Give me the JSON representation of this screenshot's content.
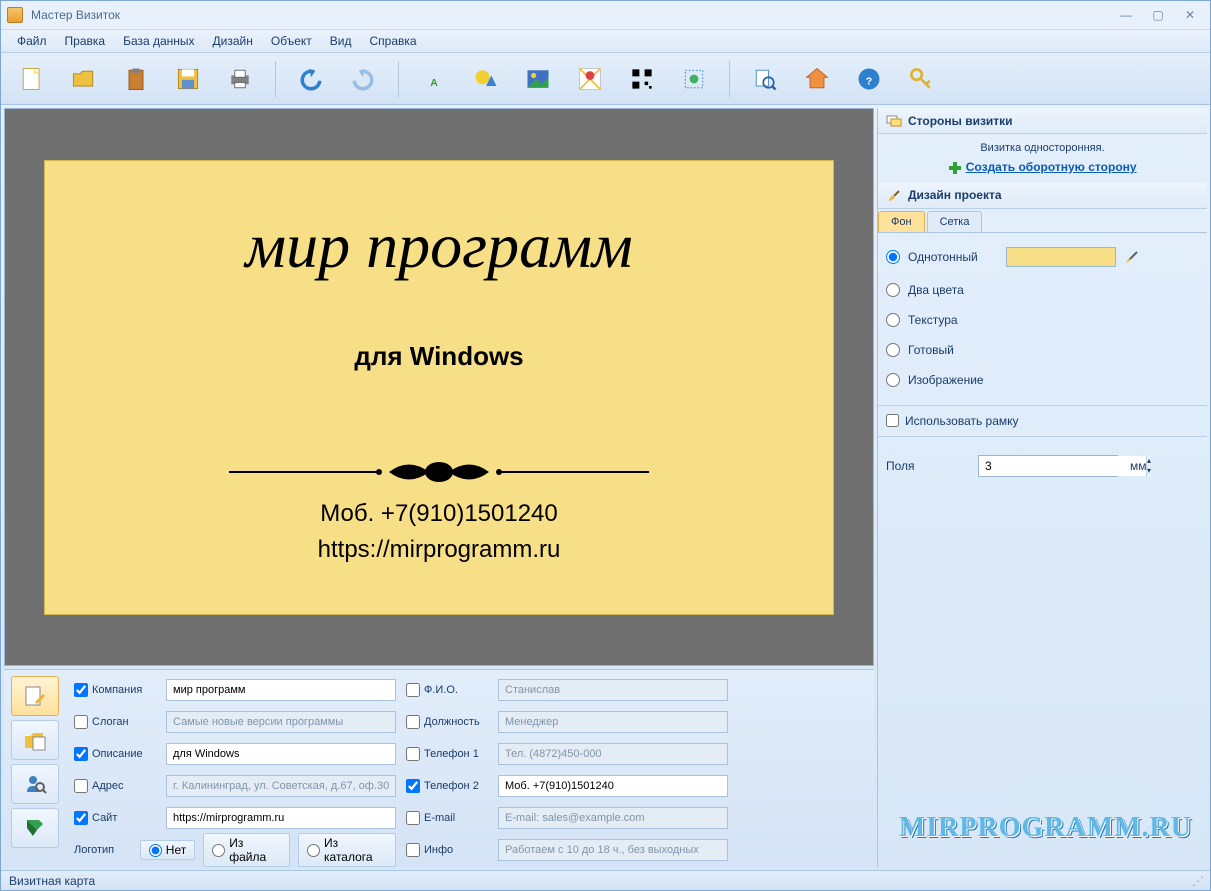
{
  "window": {
    "title": "Мастер Визиток"
  },
  "menu": [
    "Файл",
    "Правка",
    "База данных",
    "Дизайн",
    "Объект",
    "Вид",
    "Справка"
  ],
  "toolbar_icons": [
    "new",
    "open",
    "paste",
    "save",
    "print",
    "undo",
    "redo",
    "text",
    "shape",
    "image",
    "map",
    "qrcode",
    "clipart",
    "preview",
    "home",
    "help",
    "key"
  ],
  "card": {
    "company": "мир программ",
    "desc": "для Windows",
    "phone": "Моб. +7(910)1501240",
    "site": "https://mirprogramm.ru"
  },
  "fields": {
    "company": {
      "label": "Компания",
      "checked": true,
      "value": "мир программ"
    },
    "slogan": {
      "label": "Слоган",
      "checked": false,
      "value": "Самые новые версии программы"
    },
    "desc": {
      "label": "Описание",
      "checked": true,
      "value": "для Windows"
    },
    "address": {
      "label": "Адрес",
      "checked": false,
      "value": "г. Калининград, ул. Советская, д.67, оф.30"
    },
    "site": {
      "label": "Сайт",
      "checked": true,
      "value": "https://mirprogramm.ru"
    },
    "logo_label": "Логотип",
    "logo_none": "Нет",
    "logo_file": "Из файла",
    "logo_catalog": "Из каталога",
    "fio": {
      "label": "Ф.И.О.",
      "checked": false,
      "value": "Станислав"
    },
    "position": {
      "label": "Должность",
      "checked": false,
      "value": "Менеджер"
    },
    "phone1": {
      "label": "Телефон 1",
      "checked": false,
      "value": "Тел. (4872)450-000"
    },
    "phone2": {
      "label": "Телефон 2",
      "checked": true,
      "value": "Моб. +7(910)1501240"
    },
    "email": {
      "label": "E-mail",
      "checked": false,
      "value": "E-mail: sales@example.com"
    },
    "info": {
      "label": "Инфо",
      "checked": false,
      "value": "Работаем с 10 до 18 ч., без выходных"
    }
  },
  "side": {
    "sides_header": "Стороны визитки",
    "single_sided": "Визитка односторонняя.",
    "create_back": "Создать оборотную сторону",
    "design_header": "Дизайн проекта",
    "tab_fon": "Фон",
    "tab_grid": "Сетка",
    "opt_solid": "Однотонный",
    "opt_two": "Два цвета",
    "opt_texture": "Текстура",
    "opt_preset": "Готовый",
    "opt_image": "Изображение",
    "use_frame": "Использовать рамку",
    "margin_label": "Поля",
    "margin_value": "3",
    "margin_unit": "мм",
    "swatch_color": "#f7df87"
  },
  "status": "Визитная карта",
  "watermark": "MIRPROGRAMM.RU"
}
